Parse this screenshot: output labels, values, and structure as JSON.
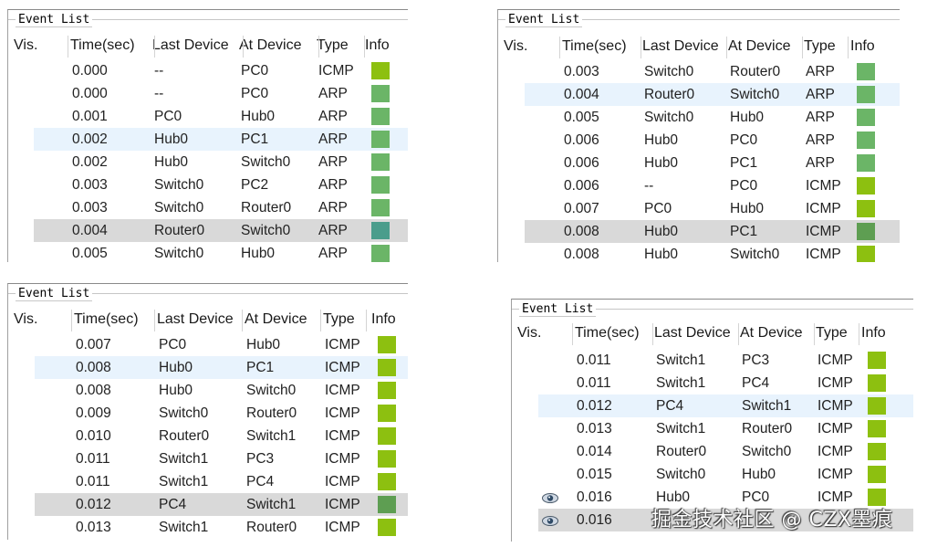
{
  "colors": {
    "icmp": "#8dc010",
    "arp": "#6bb567",
    "arp_sel": "#4a9d8c",
    "icmp_sel": "#5e9e52"
  },
  "panels": [
    {
      "title": "Event List",
      "headers": [
        "Vis.",
        "Time(sec)",
        "Last Device",
        "At Device",
        "Type",
        "Info"
      ],
      "rows": [
        {
          "vis": "",
          "time": "0.000",
          "last": "--",
          "at": "PC0",
          "type": "ICMP",
          "info_color": "#8dc010"
        },
        {
          "vis": "",
          "time": "0.000",
          "last": "--",
          "at": "PC0",
          "type": "ARP",
          "info_color": "#6bb567"
        },
        {
          "vis": "",
          "time": "0.001",
          "last": "PC0",
          "at": "Hub0",
          "type": "ARP",
          "info_color": "#6bb567"
        },
        {
          "vis": "",
          "time": "0.002",
          "last": "Hub0",
          "at": "PC1",
          "type": "ARP",
          "info_color": "#6bb567",
          "state": "hl"
        },
        {
          "vis": "",
          "time": "0.002",
          "last": "Hub0",
          "at": "Switch0",
          "type": "ARP",
          "info_color": "#6bb567"
        },
        {
          "vis": "",
          "time": "0.003",
          "last": "Switch0",
          "at": "PC2",
          "type": "ARP",
          "info_color": "#6bb567"
        },
        {
          "vis": "",
          "time": "0.003",
          "last": "Switch0",
          "at": "Router0",
          "type": "ARP",
          "info_color": "#6bb567"
        },
        {
          "vis": "",
          "time": "0.004",
          "last": "Router0",
          "at": "Switch0",
          "type": "ARP",
          "info_color": "#4a9d8c",
          "state": "sel"
        },
        {
          "vis": "",
          "time": "0.005",
          "last": "Switch0",
          "at": "Hub0",
          "type": "ARP",
          "info_color": "#6bb567"
        }
      ]
    },
    {
      "title": "Event List",
      "headers": [
        "Vis.",
        "Time(sec)",
        "Last Device",
        "At Device",
        "Type",
        "Info"
      ],
      "rows": [
        {
          "vis": "",
          "time": "0.003",
          "last": "Switch0",
          "at": "Router0",
          "type": "ARP",
          "info_color": "#6bb567"
        },
        {
          "vis": "",
          "time": "0.004",
          "last": "Router0",
          "at": "Switch0",
          "type": "ARP",
          "info_color": "#6bb567",
          "state": "hl"
        },
        {
          "vis": "",
          "time": "0.005",
          "last": "Switch0",
          "at": "Hub0",
          "type": "ARP",
          "info_color": "#6bb567"
        },
        {
          "vis": "",
          "time": "0.006",
          "last": "Hub0",
          "at": "PC0",
          "type": "ARP",
          "info_color": "#6bb567"
        },
        {
          "vis": "",
          "time": "0.006",
          "last": "Hub0",
          "at": "PC1",
          "type": "ARP",
          "info_color": "#6bb567"
        },
        {
          "vis": "",
          "time": "0.006",
          "last": "--",
          "at": "PC0",
          "type": "ICMP",
          "info_color": "#8dc010"
        },
        {
          "vis": "",
          "time": "0.007",
          "last": "PC0",
          "at": "Hub0",
          "type": "ICMP",
          "info_color": "#8dc010"
        },
        {
          "vis": "",
          "time": "0.008",
          "last": "Hub0",
          "at": "PC1",
          "type": "ICMP",
          "info_color": "#5e9e52",
          "state": "sel"
        },
        {
          "vis": "",
          "time": "0.008",
          "last": "Hub0",
          "at": "Switch0",
          "type": "ICMP",
          "info_color": "#8dc010"
        }
      ]
    },
    {
      "title": "Event List",
      "headers": [
        "Vis.",
        "Time(sec)",
        "Last Device",
        "At Device",
        "Type",
        "Info"
      ],
      "rows": [
        {
          "vis": "",
          "time": "0.007",
          "last": "PC0",
          "at": "Hub0",
          "type": "ICMP",
          "info_color": "#8dc010"
        },
        {
          "vis": "",
          "time": "0.008",
          "last": "Hub0",
          "at": "PC1",
          "type": "ICMP",
          "info_color": "#8dc010",
          "state": "hl"
        },
        {
          "vis": "",
          "time": "0.008",
          "last": "Hub0",
          "at": "Switch0",
          "type": "ICMP",
          "info_color": "#8dc010"
        },
        {
          "vis": "",
          "time": "0.009",
          "last": "Switch0",
          "at": "Router0",
          "type": "ICMP",
          "info_color": "#8dc010"
        },
        {
          "vis": "",
          "time": "0.010",
          "last": "Router0",
          "at": "Switch1",
          "type": "ICMP",
          "info_color": "#8dc010"
        },
        {
          "vis": "",
          "time": "0.011",
          "last": "Switch1",
          "at": "PC3",
          "type": "ICMP",
          "info_color": "#8dc010"
        },
        {
          "vis": "",
          "time": "0.011",
          "last": "Switch1",
          "at": "PC4",
          "type": "ICMP",
          "info_color": "#8dc010"
        },
        {
          "vis": "",
          "time": "0.012",
          "last": "PC4",
          "at": "Switch1",
          "type": "ICMP",
          "info_color": "#5e9e52",
          "state": "sel"
        },
        {
          "vis": "",
          "time": "0.013",
          "last": "Switch1",
          "at": "Router0",
          "type": "ICMP",
          "info_color": "#8dc010"
        }
      ]
    },
    {
      "title": "Event List",
      "headers": [
        "Vis.",
        "Time(sec)",
        "Last Device",
        "At Device",
        "Type",
        "Info"
      ],
      "rows": [
        {
          "vis": "",
          "time": "0.011",
          "last": "Switch1",
          "at": "PC3",
          "type": "ICMP",
          "info_color": "#8dc010"
        },
        {
          "vis": "",
          "time": "0.011",
          "last": "Switch1",
          "at": "PC4",
          "type": "ICMP",
          "info_color": "#8dc010"
        },
        {
          "vis": "",
          "time": "0.012",
          "last": "PC4",
          "at": "Switch1",
          "type": "ICMP",
          "info_color": "#8dc010",
          "state": "hl"
        },
        {
          "vis": "",
          "time": "0.013",
          "last": "Switch1",
          "at": "Router0",
          "type": "ICMP",
          "info_color": "#8dc010"
        },
        {
          "vis": "",
          "time": "0.014",
          "last": "Router0",
          "at": "Switch0",
          "type": "ICMP",
          "info_color": "#8dc010"
        },
        {
          "vis": "",
          "time": "0.015",
          "last": "Switch0",
          "at": "Hub0",
          "type": "ICMP",
          "info_color": "#8dc010"
        },
        {
          "vis": "eye-icon",
          "time": "0.016",
          "last": "Hub0",
          "at": "PC0",
          "type": "ICMP",
          "info_color": "#8dc010"
        },
        {
          "vis": "eye-icon",
          "time": "0.016",
          "last": "",
          "at": "",
          "type": "",
          "info_color": "",
          "state": "sel"
        }
      ]
    }
  ],
  "watermark": "掘金技术社区 @ CZX墨痕"
}
